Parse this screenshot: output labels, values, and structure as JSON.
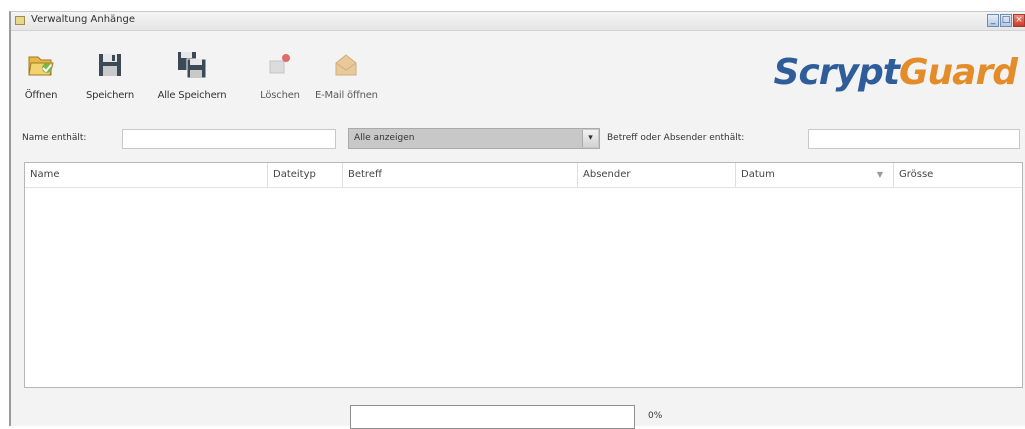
{
  "window": {
    "title": "Verwaltung Anhänge",
    "controls": [
      "minimize",
      "maximize",
      "close"
    ]
  },
  "toolbar": {
    "buttons": [
      {
        "label": "Öffnen",
        "icon": "folder-open-icon",
        "enabled": true
      },
      {
        "label": "Speichern",
        "icon": "floppy-disk-icon",
        "enabled": true
      },
      {
        "label": "Alle Speichern",
        "icon": "save-all-icon",
        "enabled": true
      },
      {
        "label": "Löschen",
        "icon": "delete-icon",
        "enabled": false
      },
      {
        "label": "E-Mail öffnen",
        "icon": "open-email-icon",
        "enabled": false
      }
    ]
  },
  "logo": {
    "part1": "Scrypt",
    "part2": "Guard"
  },
  "filters": {
    "name_label": "Name enthält:",
    "name_value": "",
    "type_select_value": "Alle anzeigen",
    "subject_label": "Betreff oder Absender enthält:",
    "subject_value": ""
  },
  "table": {
    "columns": [
      "Name",
      "Dateityp",
      "Betreff",
      "Absender",
      "Datum",
      "Grösse"
    ],
    "rows": []
  },
  "progress": {
    "value": 0,
    "text": "0%"
  }
}
